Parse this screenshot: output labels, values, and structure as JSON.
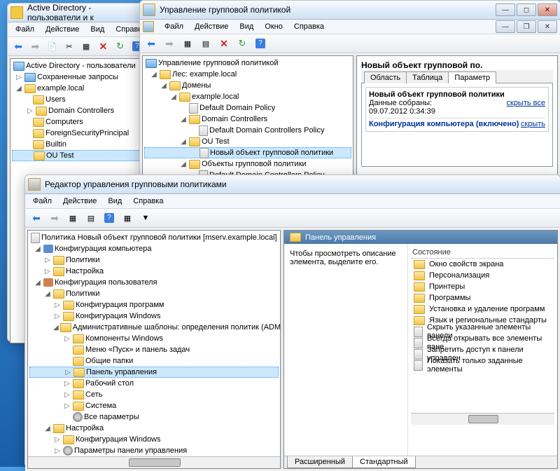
{
  "win1": {
    "title": "Active Directory - пользователи и к",
    "menu": [
      "Файл",
      "Действие",
      "Вид",
      "Справка"
    ],
    "tree": {
      "root": "Active Directory - пользователи",
      "items": [
        {
          "label": "Сохраненные запросы",
          "t": "f"
        },
        {
          "label": "example.local",
          "t": "d",
          "exp": true,
          "children": [
            {
              "label": "Users",
              "t": "f"
            },
            {
              "label": "Domain Controllers",
              "t": "o"
            },
            {
              "label": "Computers",
              "t": "f"
            },
            {
              "label": "ForeignSecurityPrincipal",
              "t": "f"
            },
            {
              "label": "Builtin",
              "t": "f"
            },
            {
              "label": "OU Test",
              "t": "o",
              "sel": true
            }
          ]
        }
      ]
    }
  },
  "win2": {
    "title": "Управление групповой политикой",
    "menu": [
      "Файл",
      "Действие",
      "Вид",
      "Окно",
      "Справка"
    ],
    "tree": {
      "root": "Управление групповой политикой",
      "forest": "Лес: example.local",
      "domains": "Домены",
      "domain": "example.local",
      "items": [
        {
          "label": "Default Domain Policy",
          "t": "p"
        },
        {
          "label": "Domain Controllers",
          "t": "o",
          "exp": true,
          "children": [
            {
              "label": "Default Domain Controllers Policy",
              "t": "p"
            }
          ]
        },
        {
          "label": "OU Test",
          "t": "o",
          "exp": true,
          "children": [
            {
              "label": "Новый объект групповой политики",
              "t": "p",
              "sel": true
            }
          ]
        },
        {
          "label": "Объекты групповой политики",
          "t": "f",
          "exp": true,
          "children": [
            {
              "label": "Default Domain Controllers Policy",
              "t": "p"
            }
          ]
        }
      ]
    },
    "right": {
      "title": "Новый объект групповой по.",
      "tabs": [
        "Область",
        "Таблица",
        "Параметр"
      ],
      "box": {
        "h": "Новый объект групповой политики",
        "l1": "Данные собраны:",
        "l2": "09.07.2012 0:34:39",
        "hide": "скрыть все",
        "cfg": "Конфигурация компьютера (включено)",
        "hide2": "скрыть"
      }
    }
  },
  "win3": {
    "title": "Редактор управления групповыми политиками",
    "menu": [
      "Файл",
      "Действие",
      "Вид",
      "Справка"
    ],
    "root": "Политика Новый объект групповой политики [mserv.example.local]",
    "tree": [
      {
        "label": "Конфигурация компьютера",
        "t": "c",
        "exp": true,
        "children": [
          {
            "label": "Политики",
            "t": "f"
          },
          {
            "label": "Настройка",
            "t": "f"
          }
        ]
      },
      {
        "label": "Конфигурация пользователя",
        "t": "c",
        "exp": true,
        "children": [
          {
            "label": "Политики",
            "t": "f",
            "exp": true,
            "children": [
              {
                "label": "Конфигурация программ",
                "t": "f"
              },
              {
                "label": "Конфигурация Windows",
                "t": "f"
              },
              {
                "label": "Административные шаблоны: определения политик (ADMX-фа",
                "t": "f",
                "exp": true,
                "children": [
                  {
                    "label": "Компоненты Windows",
                    "t": "f"
                  },
                  {
                    "label": "Меню «Пуск» и панель задач",
                    "t": "f"
                  },
                  {
                    "label": "Общие папки",
                    "t": "f"
                  },
                  {
                    "label": "Панель управления",
                    "t": "f",
                    "sel": true
                  },
                  {
                    "label": "Рабочий стол",
                    "t": "f"
                  },
                  {
                    "label": "Сеть",
                    "t": "f"
                  },
                  {
                    "label": "Система",
                    "t": "f"
                  },
                  {
                    "label": "Все параметры",
                    "t": "g"
                  }
                ]
              }
            ]
          },
          {
            "label": "Настройка",
            "t": "f",
            "exp": true,
            "children": [
              {
                "label": "Конфигурация Windows",
                "t": "f"
              },
              {
                "label": "Параметры панели управления",
                "t": "g"
              }
            ]
          }
        ]
      }
    ],
    "right": {
      "head": "Панель управления",
      "desc": "Чтобы просмотреть описание элемента, выделите его.",
      "col": "Состояние",
      "items": [
        {
          "label": "Окно свойств экрана",
          "t": "f"
        },
        {
          "label": "Персонализация",
          "t": "f"
        },
        {
          "label": "Принтеры",
          "t": "f"
        },
        {
          "label": "Программы",
          "t": "f"
        },
        {
          "label": "Установка и удаление программ",
          "t": "f"
        },
        {
          "label": "Язык и региональные стандарты",
          "t": "f"
        },
        {
          "label": "Скрыть указанные элементы панели",
          "t": "s"
        },
        {
          "label": "Всегда открывать все элементы пане",
          "t": "s"
        },
        {
          "label": "Запретить доступ к панели управлен",
          "t": "s"
        },
        {
          "label": "Показать только заданные элементы",
          "t": "s"
        }
      ],
      "tabs": [
        "Расширенный",
        "Стандартный"
      ]
    }
  }
}
